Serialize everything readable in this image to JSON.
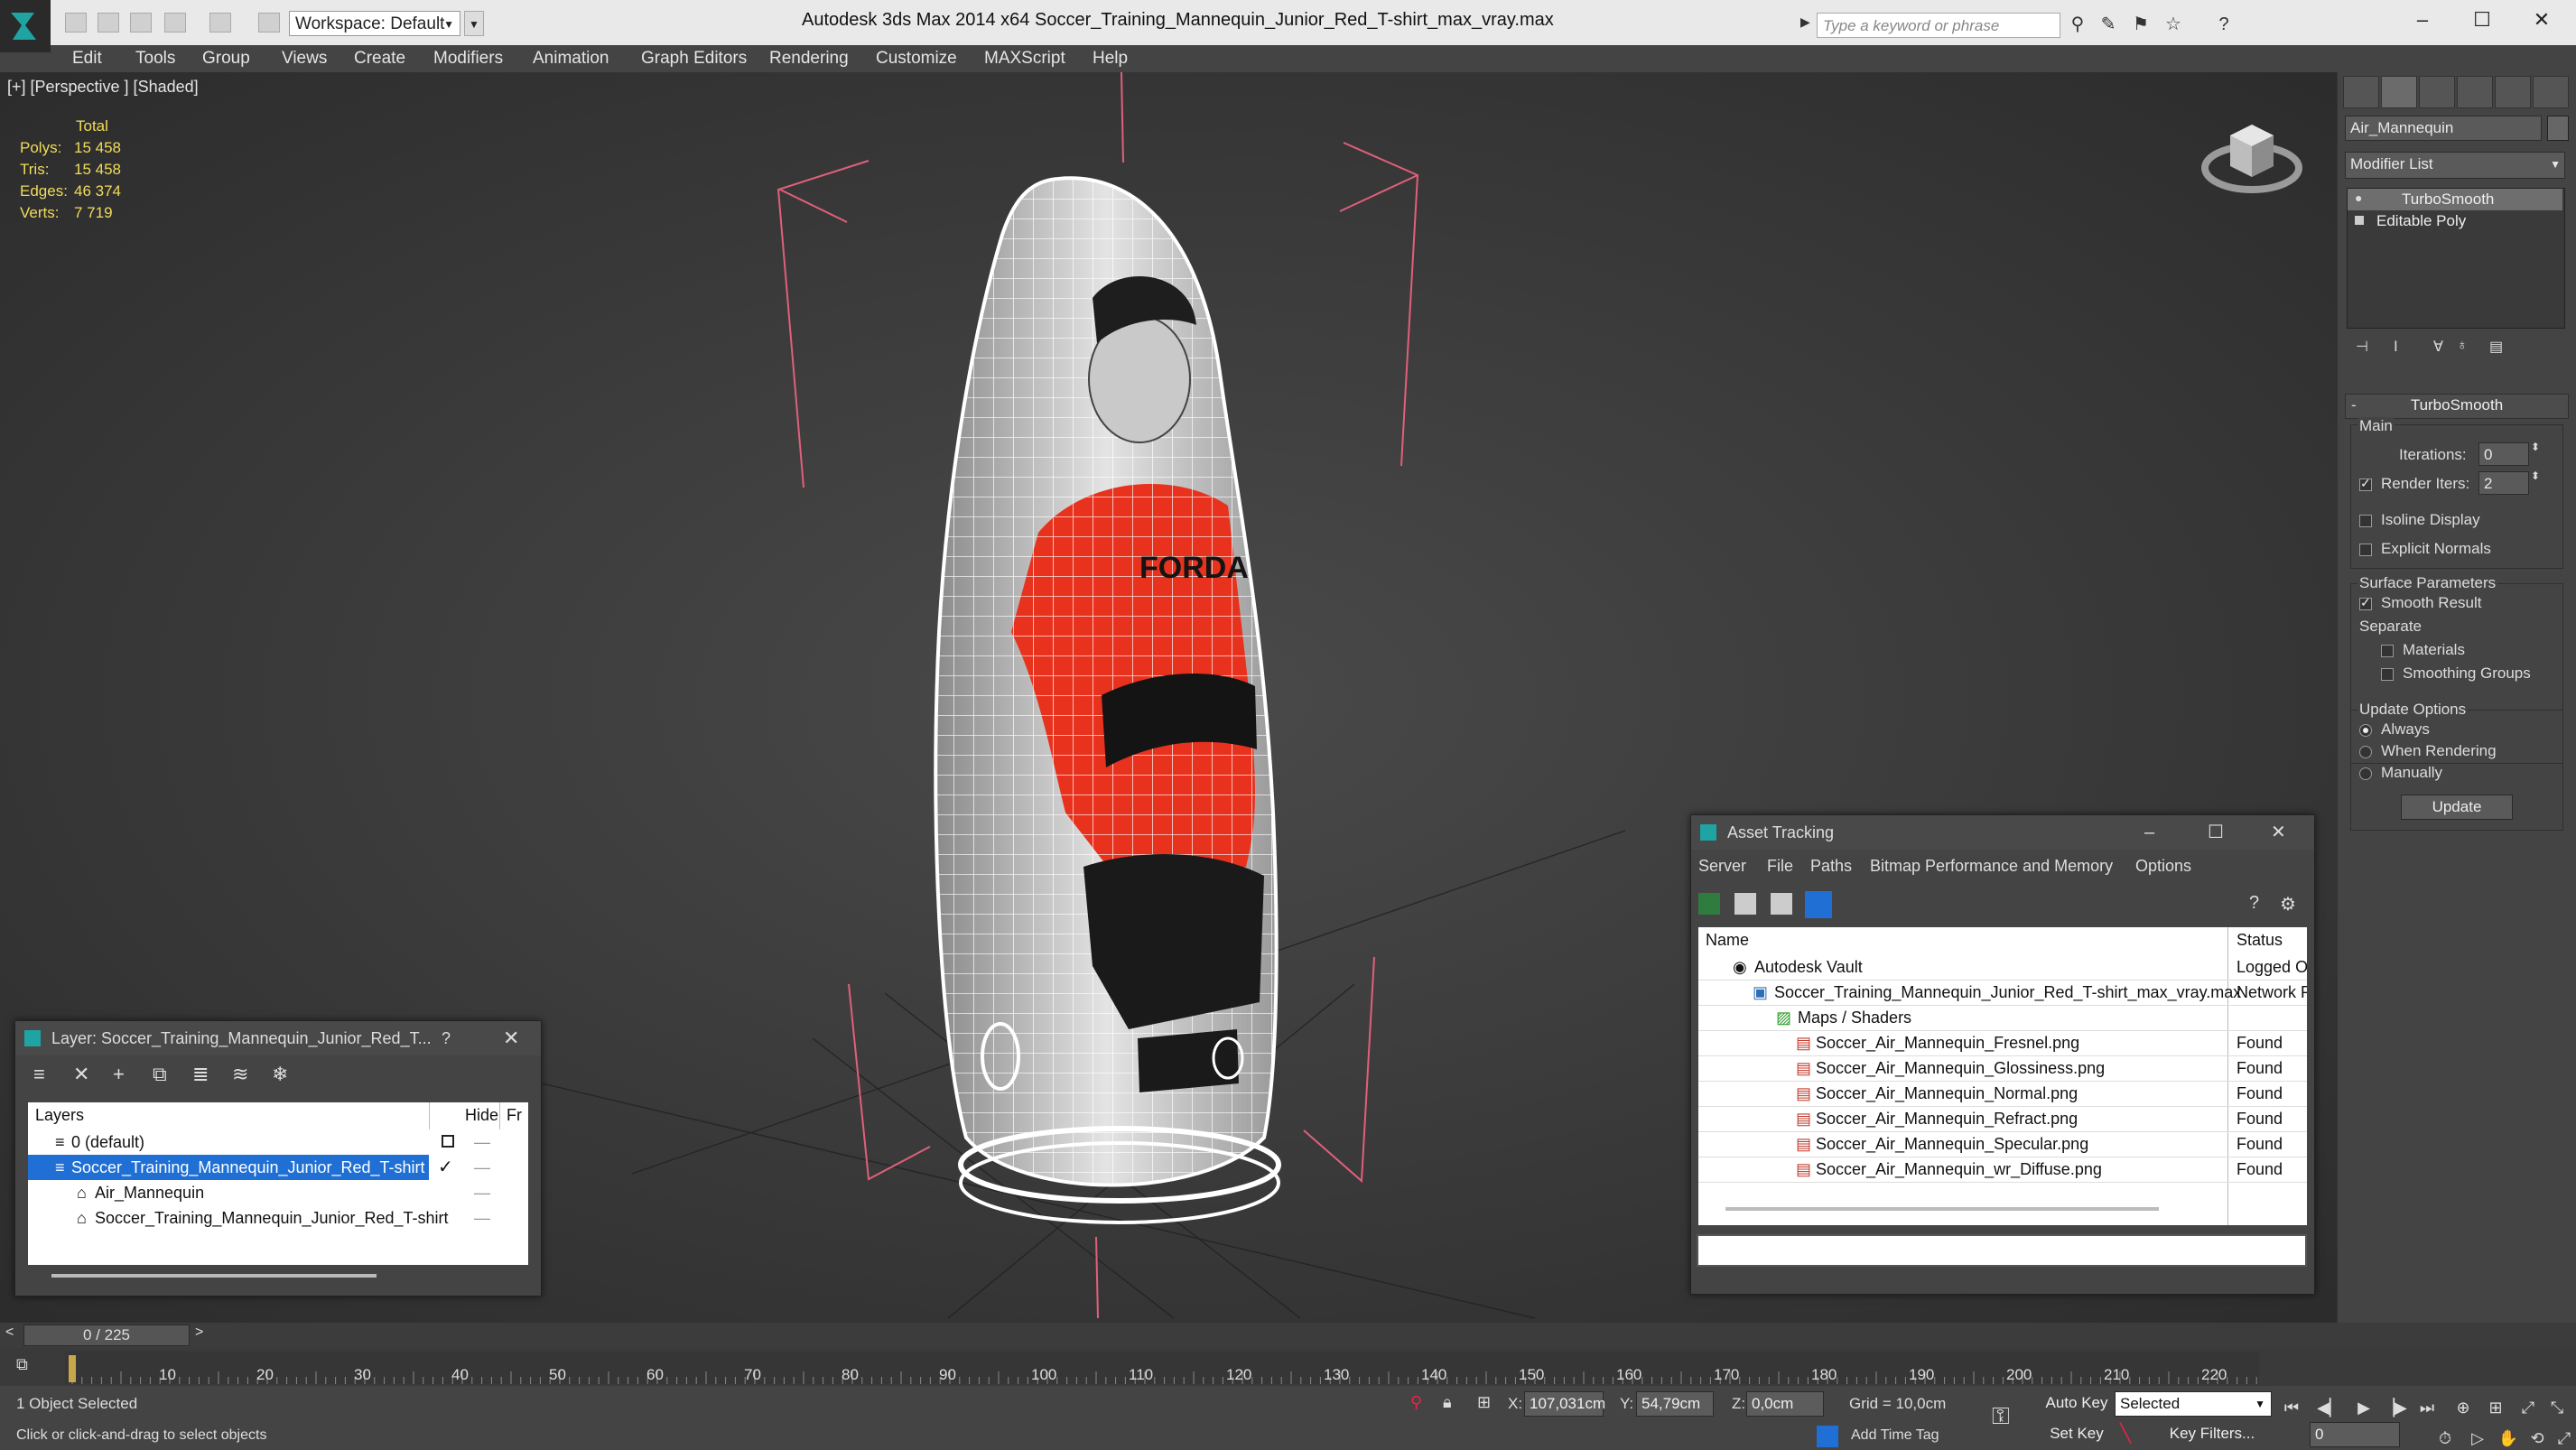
{
  "app_title": "Autodesk 3ds Max  2014 x64",
  "file_title": "Soccer_Training_Mannequin_Junior_Red_T-shirt_max_vray.max",
  "workspace": "Workspace: Default",
  "search_placeholder": "Type a keyword or phrase",
  "menu": [
    "Edit",
    "Tools",
    "Group",
    "Views",
    "Create",
    "Modifiers",
    "Animation",
    "Graph Editors",
    "Rendering",
    "Customize",
    "MAXScript",
    "Help"
  ],
  "viewport": {
    "label": "[+] [Perspective ] [Shaded]",
    "stats": {
      "header": "Total",
      "rows": [
        {
          "label": "Polys:",
          "value": "15 458"
        },
        {
          "label": "Tris:",
          "value": "15 458"
        },
        {
          "label": "Edges:",
          "value": "46 374"
        },
        {
          "label": "Verts:",
          "value": "7 719"
        }
      ]
    },
    "shirt_text": "FORDA"
  },
  "command_panel": {
    "object_name": "Air_Mannequin",
    "modifier_list": "Modifier List",
    "stack": [
      "TurboSmooth",
      "Editable Poly"
    ],
    "rollout_title": "TurboSmooth",
    "main_label": "Main",
    "iterations_label": "Iterations:",
    "iterations_value": "0",
    "render_iters_label": "Render Iters:",
    "render_iters_value": "2",
    "isoline": "Isoline Display",
    "explicit_normals": "Explicit Normals",
    "surface_params": "Surface Parameters",
    "smooth_result": "Smooth Result",
    "separate": "Separate",
    "materials": "Materials",
    "smoothing_groups": "Smoothing Groups",
    "update_options": "Update Options",
    "always": "Always",
    "when_rendering": "When Rendering",
    "manually": "Manually",
    "update_btn": "Update"
  },
  "layer_dialog": {
    "title": "Layer: Soccer_Training_Mannequin_Junior_Red_T...",
    "help": "?",
    "col_layers": "Layers",
    "col_hide": "Hide",
    "col_fr": "Fr",
    "rows": [
      {
        "name": "0 (default)",
        "indent": 0
      },
      {
        "name": "Soccer_Training_Mannequin_Junior_Red_T-shirt",
        "indent": 0
      },
      {
        "name": "Air_Mannequin",
        "indent": 1
      },
      {
        "name": "Soccer_Training_Mannequin_Junior_Red_T-shirt",
        "indent": 1
      }
    ]
  },
  "asset_dialog": {
    "title": "Asset Tracking",
    "menu": [
      "Server",
      "File",
      "Paths",
      "Bitmap Performance and Memory",
      "Options"
    ],
    "col_name": "Name",
    "col_status": "Status",
    "rows": [
      {
        "name": "Autodesk Vault",
        "status": "Logged O"
      },
      {
        "name": "Soccer_Training_Mannequin_Junior_Red_T-shirt_max_vray.max",
        "status": "Network P"
      },
      {
        "name": "Maps / Shaders",
        "status": ""
      },
      {
        "name": "Soccer_Air_Mannequin_Fresnel.png",
        "status": "Found"
      },
      {
        "name": "Soccer_Air_Mannequin_Glossiness.png",
        "status": "Found"
      },
      {
        "name": "Soccer_Air_Mannequin_Normal.png",
        "status": "Found"
      },
      {
        "name": "Soccer_Air_Mannequin_Refract.png",
        "status": "Found"
      },
      {
        "name": "Soccer_Air_Mannequin_Specular.png",
        "status": "Found"
      },
      {
        "name": "Soccer_Air_Mannequin_wr_Diffuse.png",
        "status": "Found"
      }
    ]
  },
  "timeline": {
    "frame_counter": "0 / 225",
    "prev": "<",
    "next": ">",
    "ticks": [
      "10",
      "20",
      "30",
      "40",
      "50",
      "60",
      "70",
      "80",
      "90",
      "100",
      "110",
      "120",
      "130",
      "140",
      "150",
      "160",
      "170",
      "180",
      "190",
      "200",
      "210",
      "220"
    ]
  },
  "status": {
    "selected": "1 Object Selected",
    "prompt": "Click or click-and-drag to select objects",
    "x_label": "X:",
    "x_value": "107,031cm",
    "y_label": "Y:",
    "y_value": "54,79cm",
    "z_label": "Z:",
    "z_value": "0,0cm",
    "grid": "Grid = 10,0cm",
    "add_time_tag": "Add Time Tag",
    "auto_key": "Auto Key",
    "set_key": "Set Key",
    "selected_dropdown": "Selected",
    "key_filters": "Key Filters...",
    "frame_field": "0"
  },
  "colors": {
    "accent_selection": "#1f6fd4",
    "stat_yellow": "#f0dc5a",
    "bbox_pink": "#e0607a",
    "shirt_red": "#e8321e"
  }
}
